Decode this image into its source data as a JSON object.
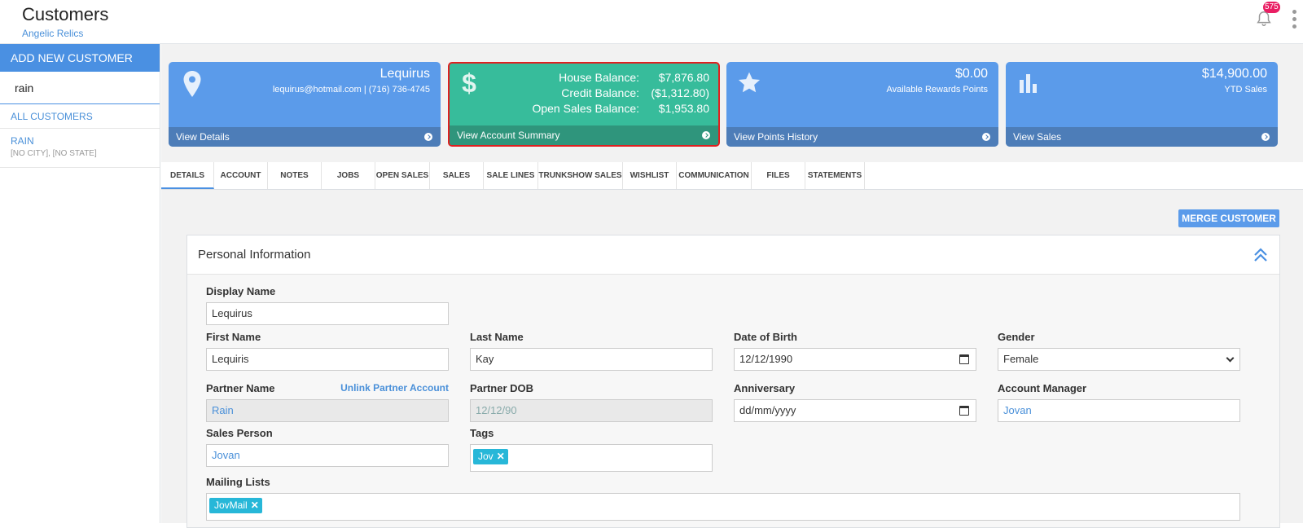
{
  "header": {
    "title": "Customers",
    "subtitle": "Angelic Relics",
    "notification_count": "575"
  },
  "sidebar": {
    "add_button": "ADD NEW CUSTOMER",
    "search_value": "rain",
    "all_customers": "ALL CUSTOMERS",
    "customers": [
      {
        "name": "RAIN",
        "location": "[NO CITY], [NO STATE]"
      }
    ]
  },
  "cards": {
    "contact": {
      "name": "Lequirus",
      "info": "lequirus@hotmail.com | (716) 736-4745",
      "link": "View Details",
      "icon": "map-pin-icon"
    },
    "balance": {
      "rows": [
        {
          "label": "House Balance:",
          "value": "$7,876.80"
        },
        {
          "label": "Credit Balance:",
          "value": "($1,312.80)"
        },
        {
          "label": "Open Sales Balance:",
          "value": "$1,953.80"
        }
      ],
      "link": "View Account Summary",
      "icon": "dollar-icon"
    },
    "rewards": {
      "amount": "$0.00",
      "label": "Available Rewards Points",
      "link": "View Points History",
      "icon": "star-icon"
    },
    "sales": {
      "amount": "$14,900.00",
      "label": "YTD Sales",
      "link": "View Sales",
      "icon": "bar-chart-icon"
    }
  },
  "tabs": [
    "DETAILS",
    "ACCOUNT",
    "NOTES",
    "JOBS",
    "OPEN SALES",
    "SALES",
    "SALE LINES",
    "TRUNKSHOW SALES",
    "WISHLIST",
    "COMMUNICATION",
    "FILES",
    "STATEMENTS"
  ],
  "merge_button": "MERGE CUSTOMER",
  "panel": {
    "title": "Personal Information",
    "fields": {
      "display_name": {
        "label": "Display Name",
        "value": "Lequirus"
      },
      "first_name": {
        "label": "First Name",
        "value": "Lequiris"
      },
      "last_name": {
        "label": "Last Name",
        "value": "Kay"
      },
      "dob": {
        "label": "Date of Birth",
        "value": "12/12/1990"
      },
      "gender": {
        "label": "Gender",
        "value": "Female"
      },
      "partner_name": {
        "label": "Partner Name",
        "value": "Rain",
        "link": "Unlink Partner Account"
      },
      "partner_dob": {
        "label": "Partner DOB",
        "value": "12/12/90"
      },
      "anniversary": {
        "label": "Anniversary",
        "value": "dd/mm/yyyy"
      },
      "account_manager": {
        "label": "Account Manager",
        "value": "Jovan"
      },
      "sales_person": {
        "label": "Sales Person",
        "value": "Jovan"
      },
      "tags": {
        "label": "Tags",
        "values": [
          "Jov"
        ]
      },
      "mailing_lists": {
        "label": "Mailing Lists",
        "values": [
          "JovMail"
        ]
      }
    }
  },
  "colors": {
    "accent": "#4a90e2",
    "card_blue": "#5b9bea",
    "card_green": "#37bc9b",
    "highlight_border": "#e02020",
    "badge": "#e91e63",
    "tag": "#27b7d8"
  }
}
